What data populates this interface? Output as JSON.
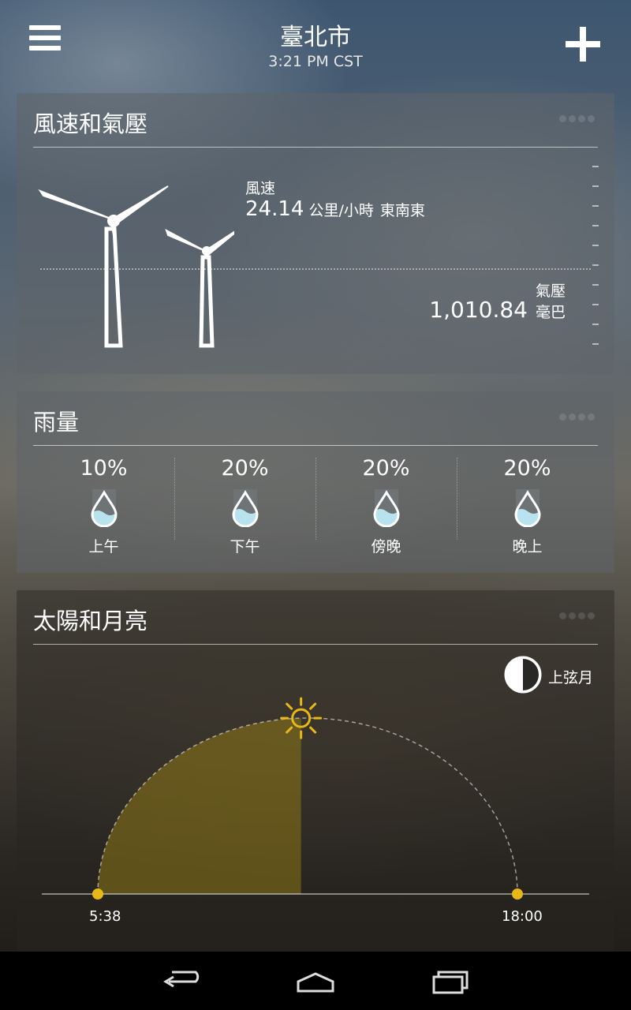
{
  "header": {
    "city": "臺北市",
    "time": "3:21 PM CST"
  },
  "wind_card": {
    "title": "風速和氣壓",
    "wind_label": "風速",
    "wind_value": "24.14",
    "wind_unit": "公里/小時",
    "wind_dir": "東南東",
    "pressure_label": "氣壓",
    "pressure_value": "1,010.84",
    "pressure_unit": "毫巴"
  },
  "rain_card": {
    "title": "雨量",
    "periods": [
      {
        "pct": "10%",
        "label": "上午"
      },
      {
        "pct": "20%",
        "label": "下午"
      },
      {
        "pct": "20%",
        "label": "傍晚"
      },
      {
        "pct": "20%",
        "label": "晚上"
      }
    ]
  },
  "sun_card": {
    "title": "太陽和月亮",
    "moon_phase": "上弦月",
    "sunrise": "5:38",
    "sunset": "18:00",
    "day_progress": 0.49
  },
  "colors": {
    "sun": "#e8b817",
    "drop_water": "#b8e3ee"
  },
  "icons": [
    "menu-icon",
    "add-icon",
    "wind-turbine-icon",
    "raindrop-icon",
    "moon-phase-icon",
    "sun-icon",
    "back-icon",
    "home-icon",
    "recents-icon"
  ]
}
